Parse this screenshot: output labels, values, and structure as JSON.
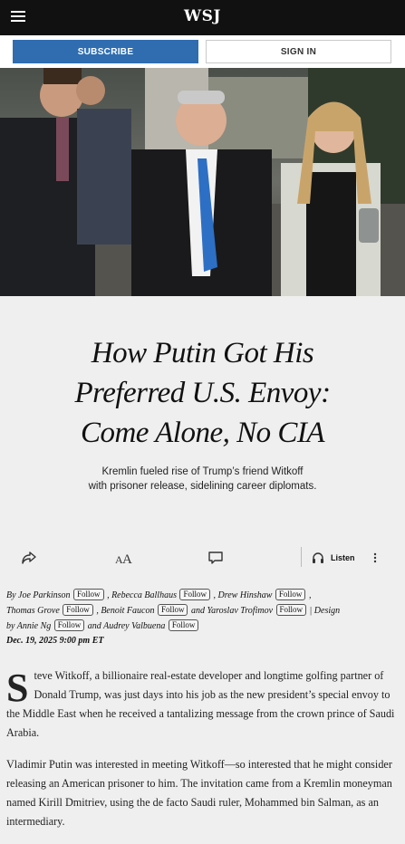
{
  "header": {
    "logo": "WSJ"
  },
  "auth": {
    "subscribe": "SUBSCRIBE",
    "signin": "SIGN IN"
  },
  "article": {
    "headline_lines": [
      "How Putin Got His",
      "Preferred U.S. Envoy:",
      "Come Alone, No CIA"
    ],
    "dek_lines": [
      "Kremlin fueled rise of Trump’s friend Witkoff",
      "with prisoner release, sidelining career diplomats."
    ],
    "toolbar": {
      "listen": "Listen"
    },
    "follow_label": "Follow",
    "authors": [
      "By Joe Parkinson",
      "Rebecca Ballhaus",
      "Drew Hinshaw",
      "Thomas Grove",
      "Benoit Faucon",
      "and Yaroslav Trofimov",
      "Annie Ng",
      "and Audrey Valbuena"
    ],
    "design_label": "Design",
    "design_by": "by",
    "date": "Dec. 19, 2025 9:00 pm ET",
    "dropcap": "S",
    "para1_rest": "teve Witkoff, a billionaire real-estate developer and longtime golfing partner of Donald Trump, was just days into his job as the new president’s special envoy to the Middle East when he received a tantalizing message from the crown prince of Saudi Arabia.",
    "para2": "Vladimir Putin was interested in meeting Witkoff—so interested that he might consider releasing an American prisoner to him. The invitation came from a Kremlin moneyman named Kirill Dmitriev, using the de facto Saudi ruler, Mohammed bin Salman, as an intermediary."
  },
  "colors": {
    "topbar": "#111111",
    "subscribe": "#2f6db0",
    "page_bg": "#efefef"
  }
}
